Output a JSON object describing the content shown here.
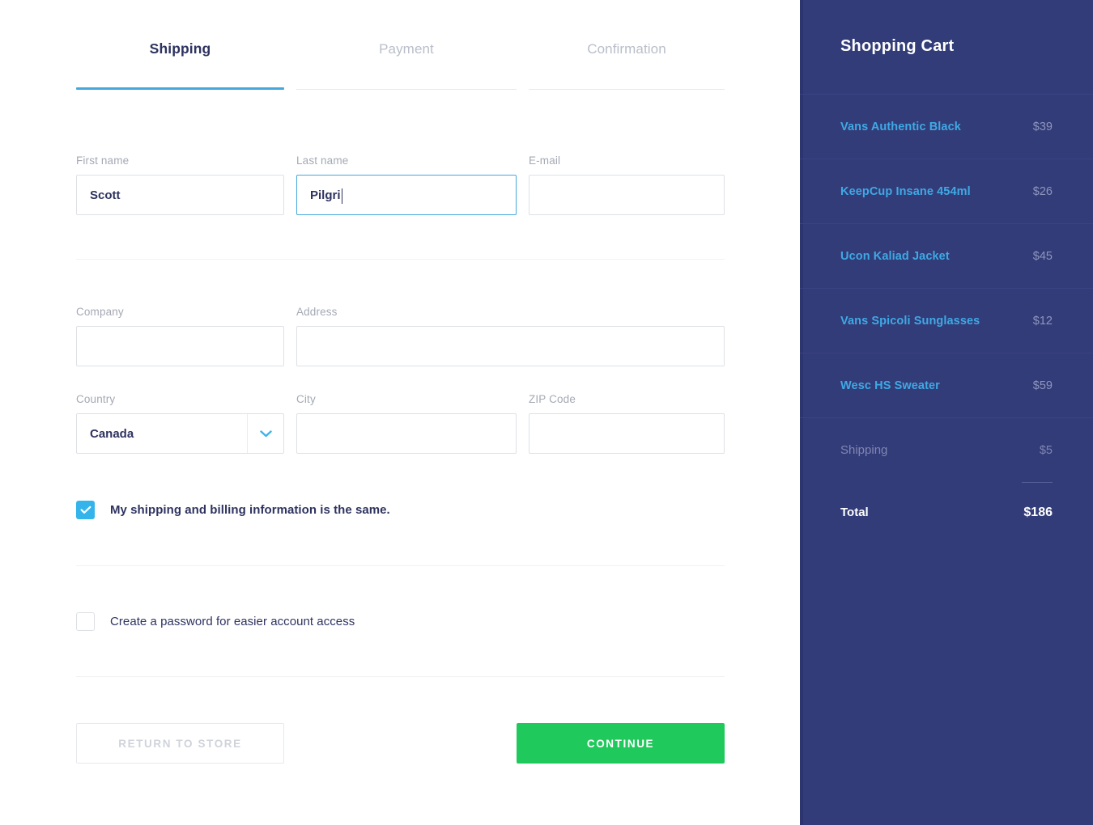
{
  "steps": [
    {
      "label": "Shipping",
      "active": true
    },
    {
      "label": "Payment",
      "active": false
    },
    {
      "label": "Confirmation",
      "active": false
    }
  ],
  "form": {
    "first_name": {
      "label": "First name",
      "value": "Scott",
      "placeholder": ""
    },
    "last_name": {
      "label": "Last name",
      "value": "Pilgri",
      "placeholder": "",
      "focused": true
    },
    "email": {
      "label": "E-mail",
      "value": "",
      "placeholder": ""
    },
    "company": {
      "label": "Company",
      "value": "",
      "placeholder": ""
    },
    "address": {
      "label": "Address",
      "value": "",
      "placeholder": ""
    },
    "country": {
      "label": "Country",
      "value": "Canada",
      "icon": "chevron-down-icon"
    },
    "city": {
      "label": "City",
      "value": "",
      "placeholder": ""
    },
    "zip": {
      "label": "ZIP Code",
      "value": "",
      "placeholder": ""
    },
    "billing_same": {
      "label": "My shipping and billing information is the same.",
      "checked": true
    },
    "create_password": {
      "label": "Create a password for easier account access",
      "checked": false
    }
  },
  "buttons": {
    "return": "RETURN TO STORE",
    "continue": "CONTINUE"
  },
  "cart": {
    "title": "Shopping Cart",
    "items": [
      {
        "name": "Vans Authentic Black",
        "price": "$39"
      },
      {
        "name": "KeepCup Insane 454ml",
        "price": "$26"
      },
      {
        "name": "Ucon Kaliad Jacket",
        "price": "$45"
      },
      {
        "name": "Vans Spicoli Sunglasses",
        "price": "$12"
      },
      {
        "name": "Wesc HS Sweater",
        "price": "$59"
      }
    ],
    "shipping": {
      "label": "Shipping",
      "price": "$5"
    },
    "total": {
      "label": "Total",
      "price": "$186"
    }
  },
  "colors": {
    "accent_blue": "#44a8dd",
    "link_blue": "#3fa9e5",
    "navy": "#323c78",
    "green": "#20c95c",
    "text_navy": "#2e3360",
    "muted": "#a4a9b4"
  }
}
